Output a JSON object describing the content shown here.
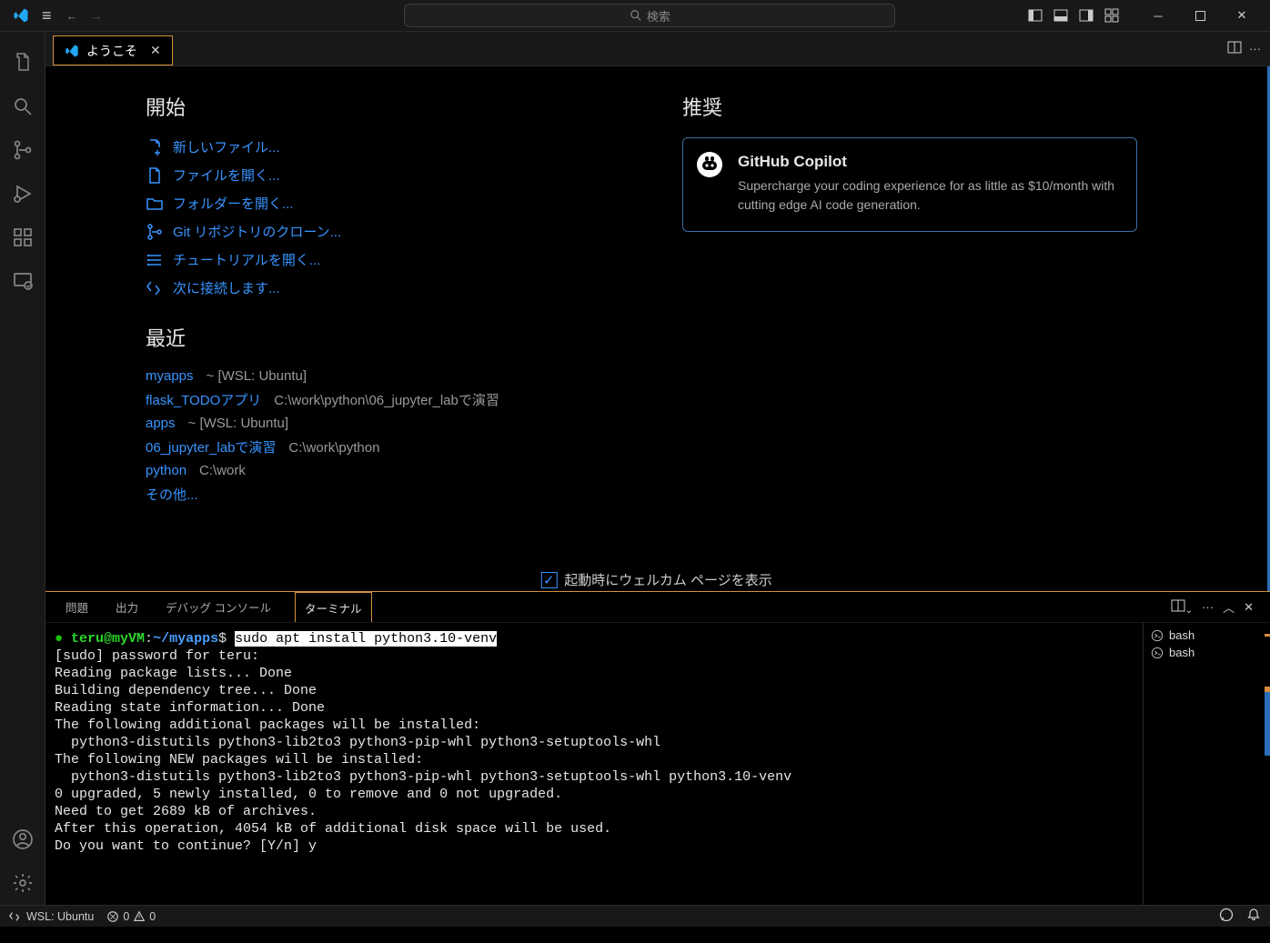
{
  "search": {
    "placeholder": "検索"
  },
  "tab": {
    "title": "ようこそ"
  },
  "welcome": {
    "start_heading": "開始",
    "start": [
      "新しいファイル...",
      "ファイルを開く...",
      "フォルダーを開く...",
      "Git リポジトリのクローン...",
      "チュートリアルを開く...",
      "次に接続します..."
    ],
    "recent_heading": "最近",
    "recent": [
      {
        "name": "myapps",
        "path": "~ [WSL: Ubuntu]"
      },
      {
        "name": "flask_TODOアプリ",
        "path": "C:\\work\\python\\06_jupyter_labで演習"
      },
      {
        "name": "apps",
        "path": "~ [WSL: Ubuntu]"
      },
      {
        "name": "06_jupyter_labで演習",
        "path": "C:\\work\\python"
      },
      {
        "name": "python",
        "path": "C:\\work"
      }
    ],
    "more": "その他...",
    "recommended_heading": "推奨",
    "copilot": {
      "title": "GitHub Copilot",
      "desc": "Supercharge your coding experience for as little as $10/month with cutting edge AI code generation."
    },
    "startup_check": "起動時にウェルカム ページを表示"
  },
  "panel": {
    "tabs": [
      "問題",
      "出力",
      "デバッグ コンソール",
      "ターミナル"
    ],
    "active": 3
  },
  "terminal": {
    "prompt_user": "teru@myVM",
    "prompt_path": "~/myapps",
    "command": "sudo apt install python3.10-venv",
    "output": "[sudo] password for teru:\nReading package lists... Done\nBuilding dependency tree... Done\nReading state information... Done\nThe following additional packages will be installed:\n  python3-distutils python3-lib2to3 python3-pip-whl python3-setuptools-whl\nThe following NEW packages will be installed:\n  python3-distutils python3-lib2to3 python3-pip-whl python3-setuptools-whl python3.10-venv\n0 upgraded, 5 newly installed, 0 to remove and 0 not upgraded.\nNeed to get 2689 kB of archives.\nAfter this operation, 4054 kB of additional disk space will be used.\nDo you want to continue? [Y/n] y",
    "shells": [
      "bash",
      "bash"
    ]
  },
  "statusbar": {
    "remote": "WSL: Ubuntu",
    "errors": "0",
    "warnings": "0"
  }
}
